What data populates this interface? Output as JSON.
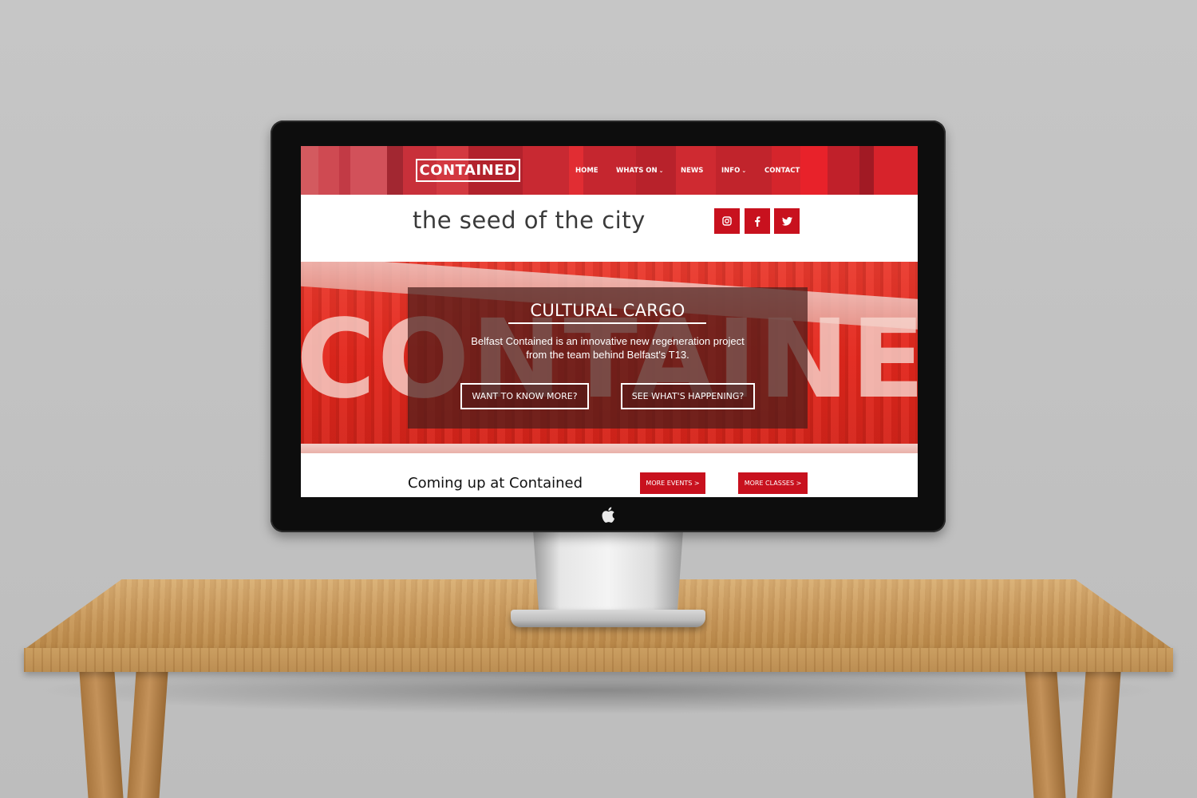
{
  "site": {
    "logo_text": "CONTAINED",
    "nav": {
      "home": "HOME",
      "whats_on": "WHATS ON",
      "news": "NEWS",
      "info": "INFO",
      "contact": "CONTACT"
    },
    "tagline": "the seed of the city",
    "social": {
      "instagram": "instagram-icon",
      "facebook": "facebook-icon",
      "twitter": "twitter-icon"
    },
    "hero": {
      "background_word": "CONTAINED",
      "title": "CULTURAL CARGO",
      "description_line1": "Belfast Contained is an innovative new regeneration project",
      "description_line2": "from the team behind Belfast's T13.",
      "button_know_more": "WANT TO KNOW MORE?",
      "button_happening": "SEE WHAT'S HAPPENING?"
    },
    "coming_up": {
      "title": "Coming up at Contained",
      "more_events": "MORE EVENTS >",
      "more_classes": "MORE CLASSES >"
    }
  },
  "colors": {
    "brand_red": "#c8111e",
    "header_red": "#c8303a",
    "hero_red": "#e3271c"
  }
}
